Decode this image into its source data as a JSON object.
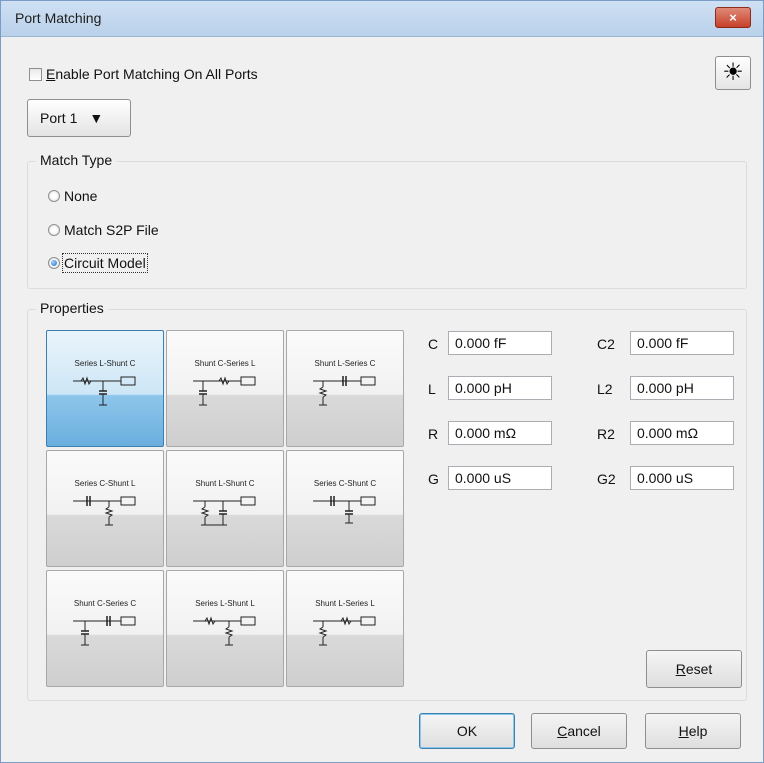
{
  "window": {
    "title": "Port Matching",
    "close_label": "×"
  },
  "enable": {
    "label_underlined": "E",
    "label_rest": "nable Port Matching On All Ports",
    "checked": false
  },
  "sun_icon": "☀",
  "port_dropdown": {
    "label": "Port 1",
    "arrow": "▼"
  },
  "match_type": {
    "title": "Match Type",
    "options": [
      {
        "label": "None",
        "selected": false
      },
      {
        "label": "Match S2P File",
        "selected": false
      },
      {
        "label": "Circuit Model",
        "selected": true
      }
    ]
  },
  "properties": {
    "title": "Properties",
    "topologies": [
      {
        "label": "Series L-Shunt C",
        "selected": true
      },
      {
        "label": "Shunt C-Series L",
        "selected": false
      },
      {
        "label": "Shunt L-Series C",
        "selected": false
      },
      {
        "label": "Series C-Shunt L",
        "selected": false
      },
      {
        "label": "Shunt L-Shunt C",
        "selected": false
      },
      {
        "label": "Series C-Shunt C",
        "selected": false
      },
      {
        "label": "Shunt C-Series C",
        "selected": false
      },
      {
        "label": "Series L-Shunt L",
        "selected": false
      },
      {
        "label": "Shunt L-Series L",
        "selected": false
      }
    ],
    "fields_left": [
      {
        "name": "C",
        "value": "0.000 fF"
      },
      {
        "name": "L",
        "value": "0.000 pH"
      },
      {
        "name": "R",
        "value": "0.000 mΩ"
      },
      {
        "name": "G",
        "value": "0.000 uS"
      }
    ],
    "fields_right": [
      {
        "name": "C2",
        "value": "0.000 fF"
      },
      {
        "name": "L2",
        "value": "0.000 pH"
      },
      {
        "name": "R2",
        "value": "0.000 mΩ"
      },
      {
        "name": "G2",
        "value": "0.000 uS"
      }
    ]
  },
  "buttons": {
    "reset_underlined": "R",
    "reset_rest": "eset",
    "ok": "OK",
    "cancel_underlined": "C",
    "cancel_rest": "ancel",
    "help_underlined": "H",
    "help_rest": "elp"
  },
  "colors": {
    "selected_tile": "#6aaede",
    "title_bar": "#b9d1ea",
    "close_button": "#c6402a"
  }
}
